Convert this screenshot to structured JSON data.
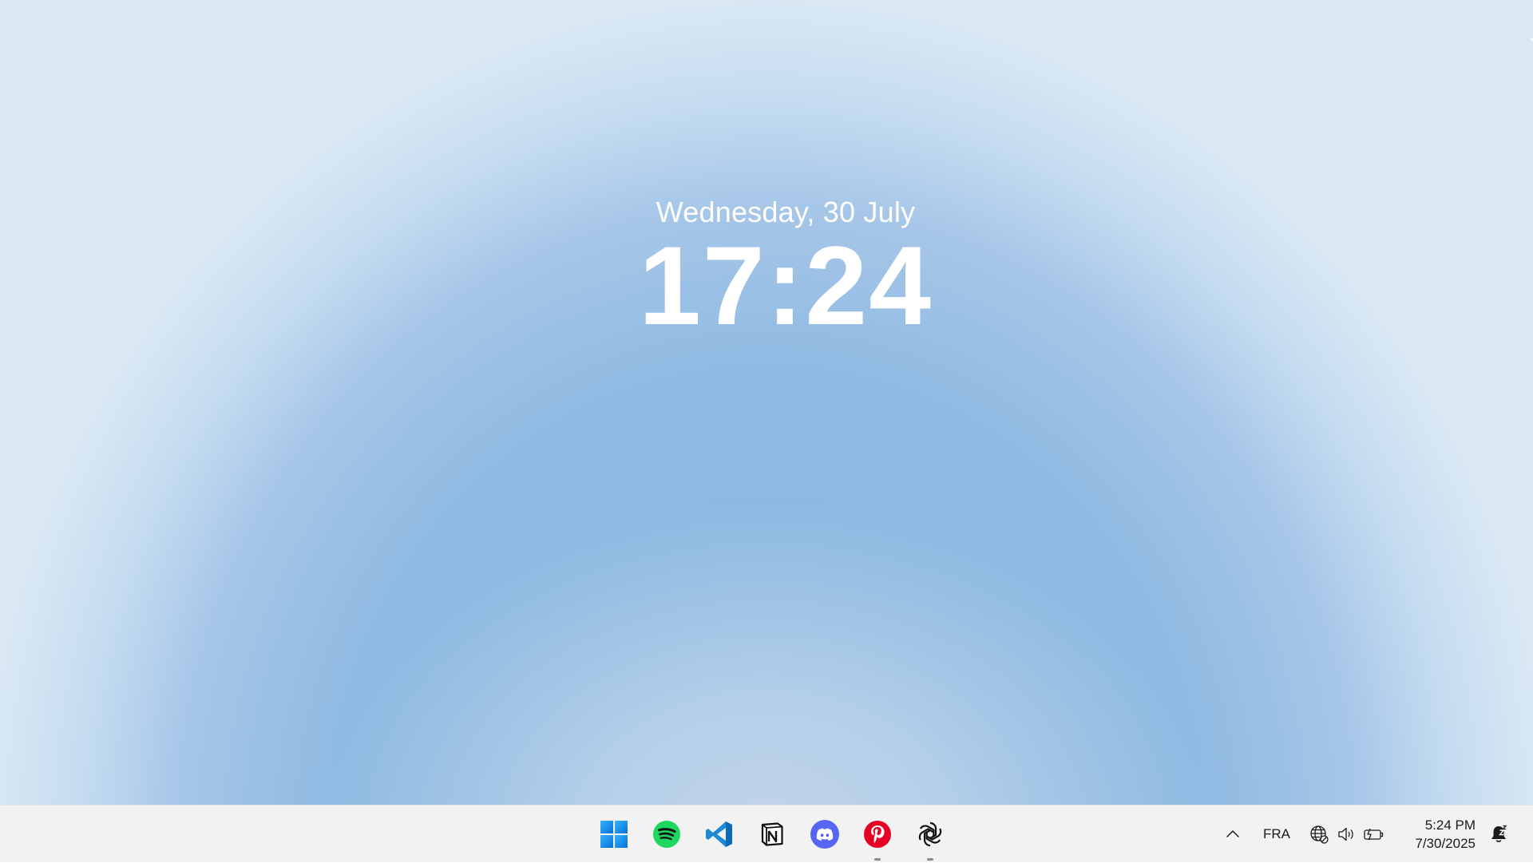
{
  "lock_screen": {
    "date": "Wednesday, 30 July",
    "time": "17:24"
  },
  "taskbar": {
    "apps": [
      {
        "name": "Start",
        "icon": "windows-start-icon",
        "running": false,
        "color": "#1a8fe3"
      },
      {
        "name": "Spotify",
        "icon": "spotify-icon",
        "running": false,
        "color": "#1ed760"
      },
      {
        "name": "Visual Studio Code",
        "icon": "vscode-icon",
        "running": false,
        "color": "#1f8ad2"
      },
      {
        "name": "Notion",
        "icon": "notion-icon",
        "running": false,
        "color": "#111111"
      },
      {
        "name": "Discord",
        "icon": "discord-icon",
        "running": false,
        "color": "#5865f2"
      },
      {
        "name": "Pinterest",
        "icon": "pinterest-icon",
        "running": true,
        "color": "#e60023"
      },
      {
        "name": "ChatGPT",
        "icon": "chatgpt-icon",
        "running": true,
        "color": "#111111"
      }
    ],
    "tray": {
      "chevron_icon": "chevron-up-icon",
      "language": "FRA",
      "icons": [
        "network-globe-icon",
        "volume-icon",
        "battery-charging-icon"
      ],
      "time": "5:24 PM",
      "date": "7/30/2025",
      "notification_icon": "notification-bell-icon"
    }
  }
}
